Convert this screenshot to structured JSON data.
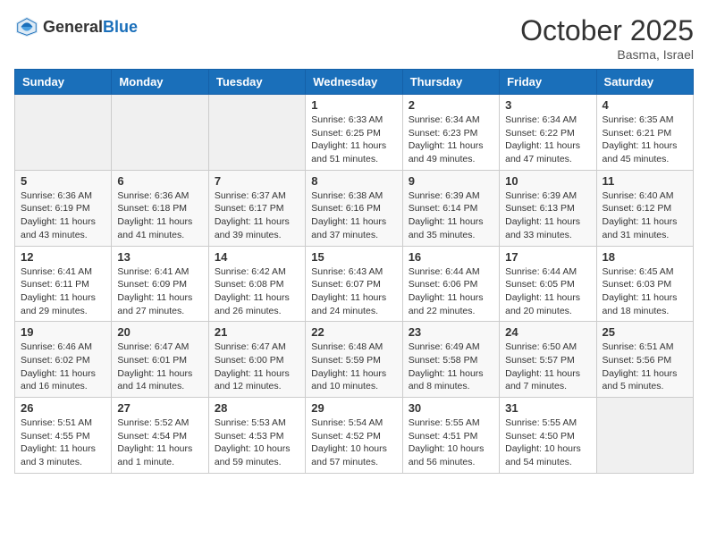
{
  "logo": {
    "general": "General",
    "blue": "Blue"
  },
  "header": {
    "month": "October 2025",
    "location": "Basma, Israel"
  },
  "weekdays": [
    "Sunday",
    "Monday",
    "Tuesday",
    "Wednesday",
    "Thursday",
    "Friday",
    "Saturday"
  ],
  "weeks": [
    [
      {
        "day": "",
        "info": ""
      },
      {
        "day": "",
        "info": ""
      },
      {
        "day": "",
        "info": ""
      },
      {
        "day": "1",
        "info": "Sunrise: 6:33 AM\nSunset: 6:25 PM\nDaylight: 11 hours\nand 51 minutes."
      },
      {
        "day": "2",
        "info": "Sunrise: 6:34 AM\nSunset: 6:23 PM\nDaylight: 11 hours\nand 49 minutes."
      },
      {
        "day": "3",
        "info": "Sunrise: 6:34 AM\nSunset: 6:22 PM\nDaylight: 11 hours\nand 47 minutes."
      },
      {
        "day": "4",
        "info": "Sunrise: 6:35 AM\nSunset: 6:21 PM\nDaylight: 11 hours\nand 45 minutes."
      }
    ],
    [
      {
        "day": "5",
        "info": "Sunrise: 6:36 AM\nSunset: 6:19 PM\nDaylight: 11 hours\nand 43 minutes."
      },
      {
        "day": "6",
        "info": "Sunrise: 6:36 AM\nSunset: 6:18 PM\nDaylight: 11 hours\nand 41 minutes."
      },
      {
        "day": "7",
        "info": "Sunrise: 6:37 AM\nSunset: 6:17 PM\nDaylight: 11 hours\nand 39 minutes."
      },
      {
        "day": "8",
        "info": "Sunrise: 6:38 AM\nSunset: 6:16 PM\nDaylight: 11 hours\nand 37 minutes."
      },
      {
        "day": "9",
        "info": "Sunrise: 6:39 AM\nSunset: 6:14 PM\nDaylight: 11 hours\nand 35 minutes."
      },
      {
        "day": "10",
        "info": "Sunrise: 6:39 AM\nSunset: 6:13 PM\nDaylight: 11 hours\nand 33 minutes."
      },
      {
        "day": "11",
        "info": "Sunrise: 6:40 AM\nSunset: 6:12 PM\nDaylight: 11 hours\nand 31 minutes."
      }
    ],
    [
      {
        "day": "12",
        "info": "Sunrise: 6:41 AM\nSunset: 6:11 PM\nDaylight: 11 hours\nand 29 minutes."
      },
      {
        "day": "13",
        "info": "Sunrise: 6:41 AM\nSunset: 6:09 PM\nDaylight: 11 hours\nand 27 minutes."
      },
      {
        "day": "14",
        "info": "Sunrise: 6:42 AM\nSunset: 6:08 PM\nDaylight: 11 hours\nand 26 minutes."
      },
      {
        "day": "15",
        "info": "Sunrise: 6:43 AM\nSunset: 6:07 PM\nDaylight: 11 hours\nand 24 minutes."
      },
      {
        "day": "16",
        "info": "Sunrise: 6:44 AM\nSunset: 6:06 PM\nDaylight: 11 hours\nand 22 minutes."
      },
      {
        "day": "17",
        "info": "Sunrise: 6:44 AM\nSunset: 6:05 PM\nDaylight: 11 hours\nand 20 minutes."
      },
      {
        "day": "18",
        "info": "Sunrise: 6:45 AM\nSunset: 6:03 PM\nDaylight: 11 hours\nand 18 minutes."
      }
    ],
    [
      {
        "day": "19",
        "info": "Sunrise: 6:46 AM\nSunset: 6:02 PM\nDaylight: 11 hours\nand 16 minutes."
      },
      {
        "day": "20",
        "info": "Sunrise: 6:47 AM\nSunset: 6:01 PM\nDaylight: 11 hours\nand 14 minutes."
      },
      {
        "day": "21",
        "info": "Sunrise: 6:47 AM\nSunset: 6:00 PM\nDaylight: 11 hours\nand 12 minutes."
      },
      {
        "day": "22",
        "info": "Sunrise: 6:48 AM\nSunset: 5:59 PM\nDaylight: 11 hours\nand 10 minutes."
      },
      {
        "day": "23",
        "info": "Sunrise: 6:49 AM\nSunset: 5:58 PM\nDaylight: 11 hours\nand 8 minutes."
      },
      {
        "day": "24",
        "info": "Sunrise: 6:50 AM\nSunset: 5:57 PM\nDaylight: 11 hours\nand 7 minutes."
      },
      {
        "day": "25",
        "info": "Sunrise: 6:51 AM\nSunset: 5:56 PM\nDaylight: 11 hours\nand 5 minutes."
      }
    ],
    [
      {
        "day": "26",
        "info": "Sunrise: 5:51 AM\nSunset: 4:55 PM\nDaylight: 11 hours\nand 3 minutes."
      },
      {
        "day": "27",
        "info": "Sunrise: 5:52 AM\nSunset: 4:54 PM\nDaylight: 11 hours\nand 1 minute."
      },
      {
        "day": "28",
        "info": "Sunrise: 5:53 AM\nSunset: 4:53 PM\nDaylight: 10 hours\nand 59 minutes."
      },
      {
        "day": "29",
        "info": "Sunrise: 5:54 AM\nSunset: 4:52 PM\nDaylight: 10 hours\nand 57 minutes."
      },
      {
        "day": "30",
        "info": "Sunrise: 5:55 AM\nSunset: 4:51 PM\nDaylight: 10 hours\nand 56 minutes."
      },
      {
        "day": "31",
        "info": "Sunrise: 5:55 AM\nSunset: 4:50 PM\nDaylight: 10 hours\nand 54 minutes."
      },
      {
        "day": "",
        "info": ""
      }
    ]
  ]
}
